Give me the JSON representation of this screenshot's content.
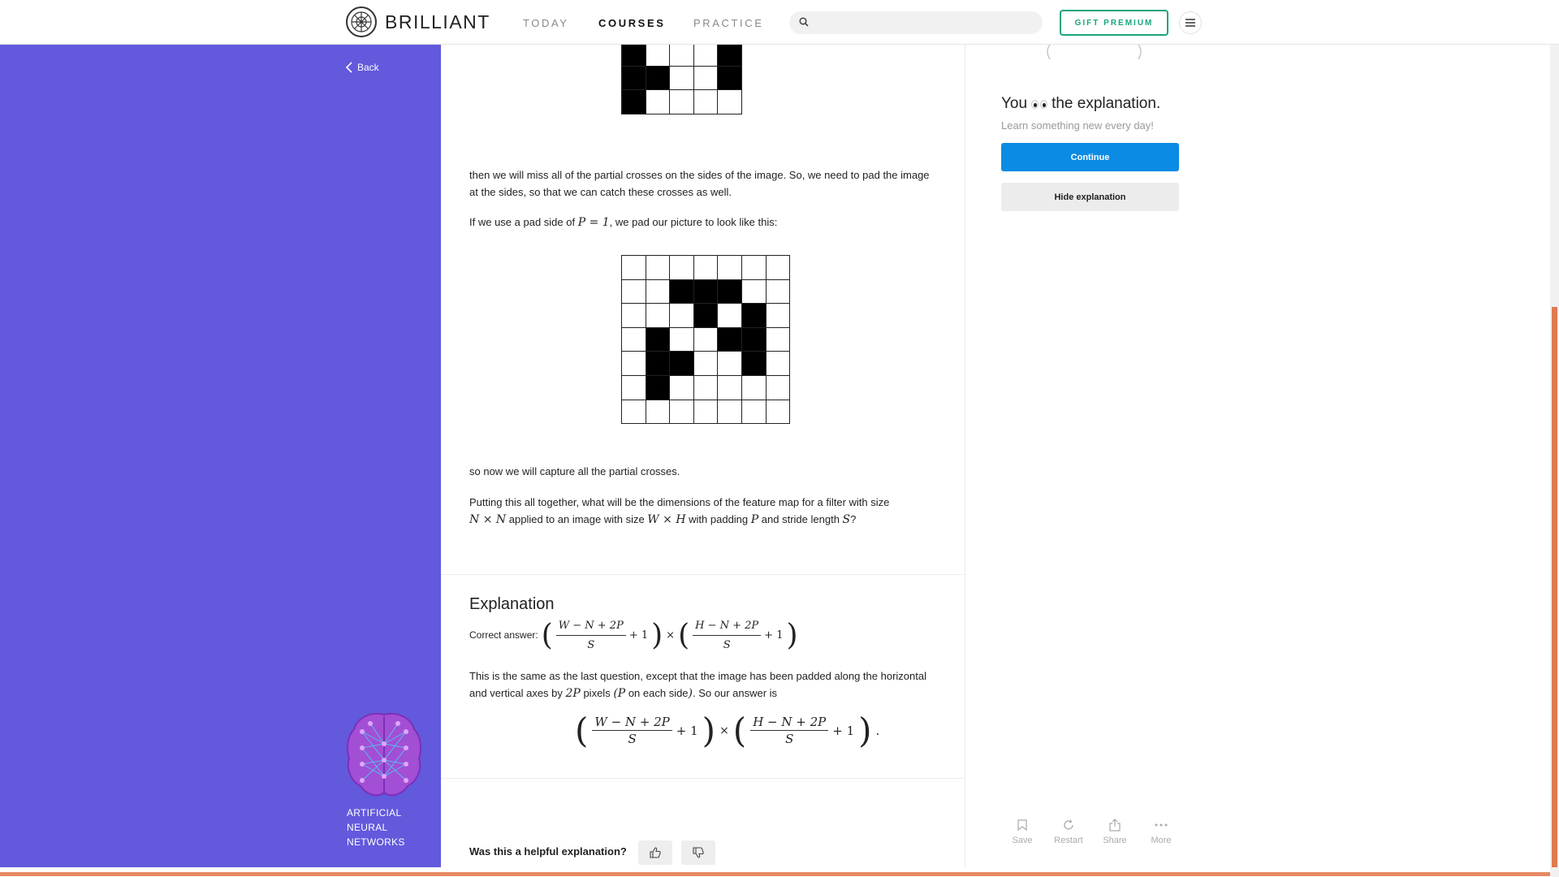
{
  "brand": {
    "name": "BRILLIANT"
  },
  "nav": {
    "today": "TODAY",
    "courses": "COURSES",
    "practice": "PRACTICE",
    "search_placeholder": "",
    "gift": "GIFT PREMIUM"
  },
  "sidebar": {
    "back": "Back",
    "course_line1": "ARTIFICIAL",
    "course_line2": "NEURAL",
    "course_line3": "NETWORKS"
  },
  "content": {
    "para1": "then we will miss all of the partial crosses on the sides of the image. So, we need to pad the image at the sides, so that we can catch these crosses as well.",
    "para2_pre": "If we use a pad side of ",
    "para2_math": "P = 1",
    "para2_post": ", we pad our picture to look like this:",
    "para3": "so now we will capture all the partial crosses.",
    "para4_a": "Putting this all together, what will be the dimensions of the feature map for a filter with size",
    "para4_m1": "N × N",
    "para4_b": " applied to an image with size ",
    "para4_m2": "W × H",
    "para4_c": " with padding ",
    "para4_m3": "P",
    "para4_d": " and stride length ",
    "para4_m4": "S",
    "para4_e": "?",
    "top_grid": [
      [
        1,
        0,
        0,
        0,
        1
      ],
      [
        1,
        1,
        0,
        0,
        1
      ],
      [
        1,
        0,
        0,
        0,
        0
      ]
    ],
    "padded_grid": [
      [
        0,
        0,
        0,
        0,
        0,
        0,
        0
      ],
      [
        0,
        0,
        1,
        1,
        1,
        0,
        0
      ],
      [
        0,
        0,
        0,
        1,
        0,
        1,
        0
      ],
      [
        0,
        1,
        0,
        0,
        1,
        1,
        0
      ],
      [
        0,
        1,
        1,
        0,
        0,
        1,
        0
      ],
      [
        0,
        1,
        0,
        0,
        0,
        0,
        0
      ],
      [
        0,
        0,
        0,
        0,
        0,
        0,
        0
      ]
    ]
  },
  "explanation": {
    "title": "Explanation",
    "correct_label": "Correct answer:",
    "num1": "W − N + 2P",
    "num2": "H − N + 2P",
    "den": "S",
    "plus_one": "+ 1",
    "times": "×",
    "body_a": "This is the same as the last question, except that the image has been padded along the horizontal and vertical axes by ",
    "body_m1": "2P",
    "body_b": " pixels ",
    "body_m2": "(P",
    "body_c": " on each side",
    "body_m3": ")",
    "body_d": ". So our answer is",
    "period": ".",
    "helpful": "Was this a helpful explanation?"
  },
  "right": {
    "you": "You",
    "the_explanation": "the explanation.",
    "learn": "Learn something new every day!",
    "continue": "Continue",
    "hide": "Hide explanation",
    "actions": {
      "save": "Save",
      "restart": "Restart",
      "share": "Share",
      "more": "More"
    }
  },
  "colors": {
    "purple": "#6259dd",
    "blue": "#0b8be4",
    "green": "#1aa57f",
    "orange": "#e88a63"
  }
}
